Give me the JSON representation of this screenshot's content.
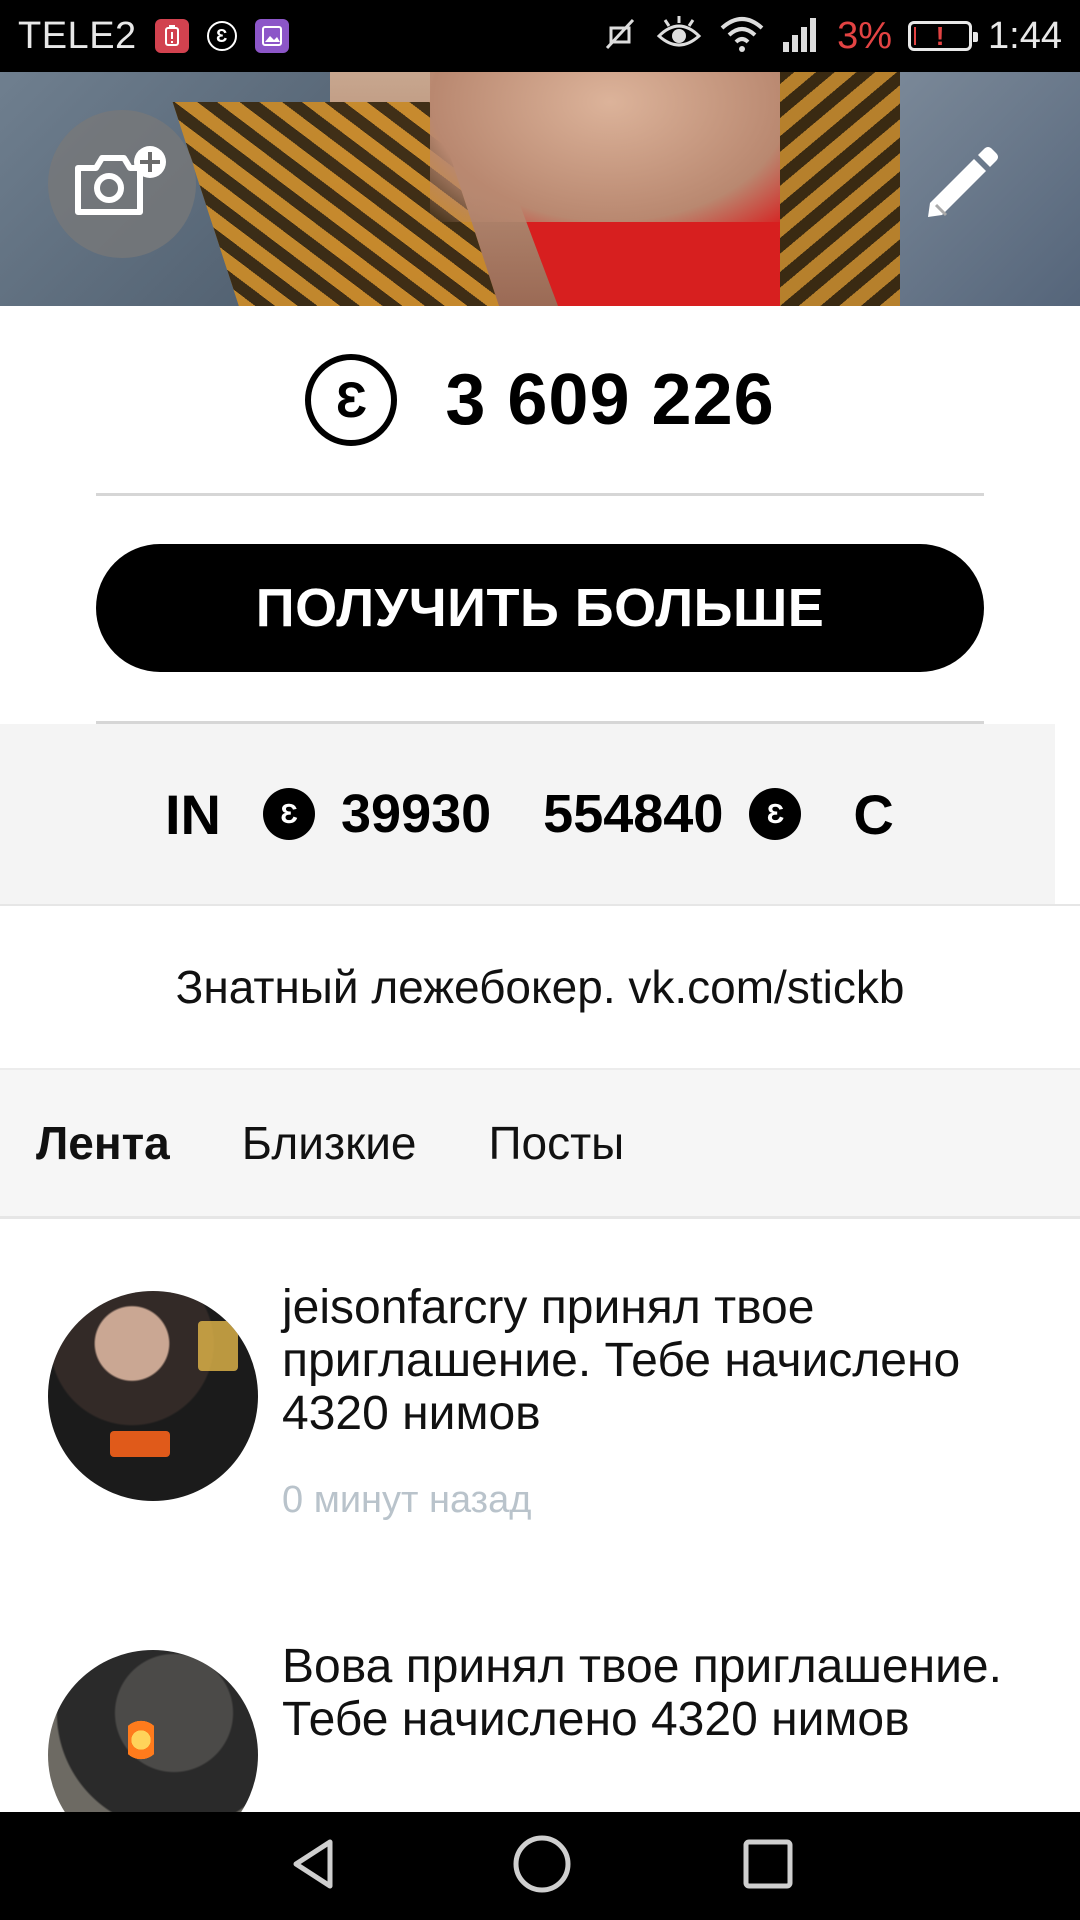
{
  "status_bar": {
    "carrier": "TELE2",
    "battery_percent": "3%",
    "time": "1:44",
    "icons": [
      "battery-alert-icon",
      "nim-coin-icon",
      "gallery-icon",
      "mute-icon",
      "eye-icon",
      "wifi-icon",
      "signal-icon",
      "battery-icon"
    ],
    "battery_level": 0.03
  },
  "cover": {
    "add_photo_icon": "camera-plus-icon",
    "edit_icon": "pencil-icon"
  },
  "balance": {
    "coin_symbol": "Ɛ",
    "value": "3 609 226"
  },
  "get_more_button": "ПОЛУЧИТЬ БОЛЬШЕ",
  "stats": {
    "label": "IN",
    "coin_symbol": "Ɛ",
    "in_value": "39930",
    "out_value": "554840",
    "next_label_partial": "C"
  },
  "profile_status": "Знатный лежебокер. vk.com/stickb",
  "tabs": [
    {
      "label": "Лента",
      "active": true
    },
    {
      "label": "Близкие",
      "active": false
    },
    {
      "label": "Посты",
      "active": false
    }
  ],
  "feed": [
    {
      "text": "jeisonfarcry принял твое приглашение. Тебе начислено 4320 нимов",
      "time": "0 минут назад"
    },
    {
      "text": "Вова принял твое приглашение. Тебе начислено 4320 нимов",
      "time": ""
    }
  ],
  "nav": {
    "back_icon": "back-icon",
    "home_icon": "home-icon",
    "recents_icon": "recents-icon"
  },
  "colors": {
    "battery_low": "#e34343",
    "time_gray": "#b9c3cb",
    "button_bg": "#000000"
  }
}
